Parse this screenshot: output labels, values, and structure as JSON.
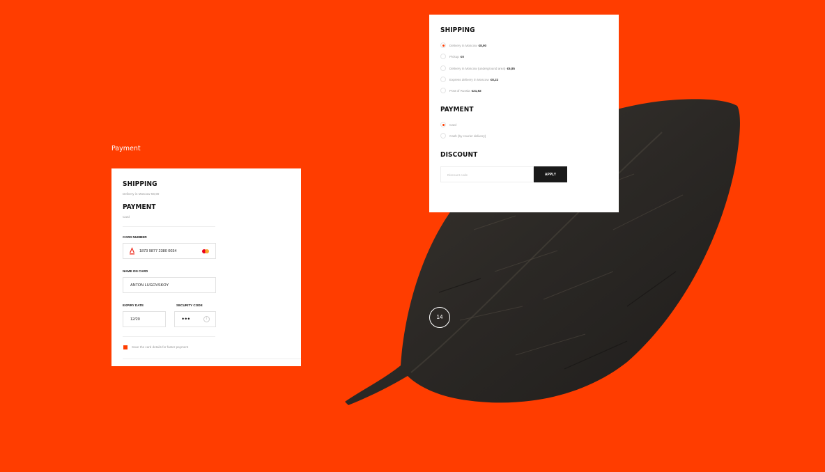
{
  "page_label": "Payment",
  "left_card": {
    "shipping_title": "SHIPPING",
    "shipping_summary": "Delivery in Moscow  €8,90",
    "payment_title": "PAYMENT",
    "payment_summary": "Card",
    "card_number_label": "CARD NUMBER",
    "card_number_value": "1873  9877  2380  0034",
    "name_label": "NAME ON CARD",
    "name_value": "ANTON LUGOVSKOY",
    "expiry_label": "EXPIRY DATE",
    "expiry_value": "12/20",
    "security_label": "SECURITY CODE",
    "security_value": "•••",
    "save_label": "Save the card details for faster payment",
    "icons": {
      "bank": "alfa-bank-icon",
      "card_brand": "mastercard-icon",
      "info": "info-icon"
    }
  },
  "right_card": {
    "shipping_title": "SHIPPING",
    "shipping_options": [
      {
        "label": "Delivery in Moscow",
        "price": "€8,90",
        "selected": true
      },
      {
        "label": "Pickup",
        "price": "€0",
        "selected": false
      },
      {
        "label": "Delivery in Moscow (underground area)",
        "price": "€6,85",
        "selected": false
      },
      {
        "label": "Express delivery in Moscow",
        "price": "€8,22",
        "selected": false
      },
      {
        "label": "Post of Russia",
        "price": "€21,92",
        "selected": false
      }
    ],
    "payment_title": "PAYMENT",
    "payment_options": [
      {
        "label": "Card",
        "selected": true
      },
      {
        "label": "Cash (by courier delivery)",
        "selected": false
      }
    ],
    "discount_title": "DISCOUNT",
    "discount_placeholder": "Discount code",
    "apply_label": "APPLY"
  },
  "page_badge": "14",
  "colors": {
    "background": "#ff3d00",
    "accent": "#ff3d00",
    "button": "#1a1a1a",
    "card": "#ffffff"
  }
}
